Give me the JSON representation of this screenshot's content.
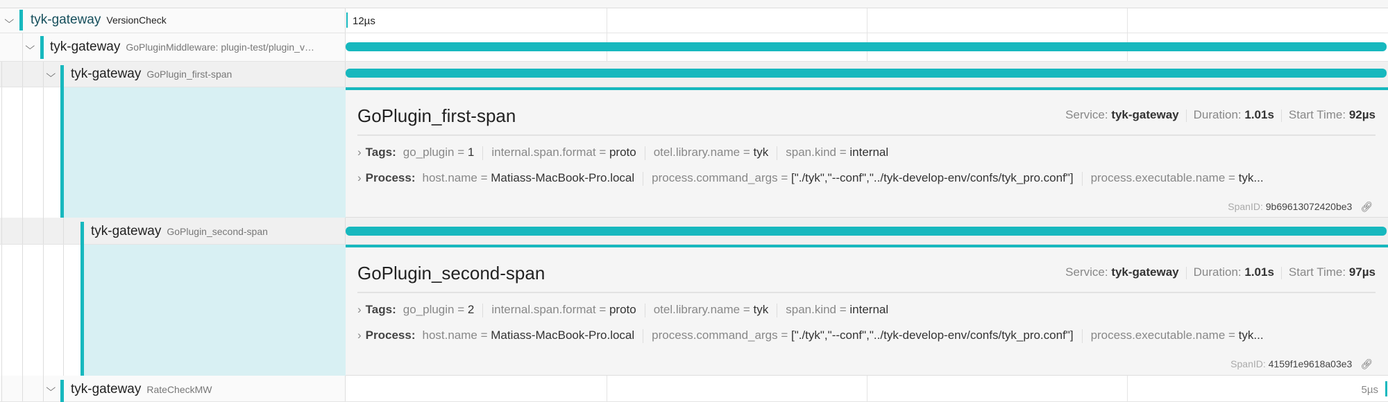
{
  "rows": [
    {
      "service": "tyk-gateway",
      "operation": "VersionCheck",
      "duration": "12µs"
    },
    {
      "service": "tyk-gateway",
      "operation": "GoPluginMiddleware: plugin-test/plugin_v…"
    },
    {
      "service": "tyk-gateway",
      "operation": "GoPlugin_first-span"
    },
    {
      "service": "tyk-gateway",
      "operation": "GoPlugin_second-span"
    },
    {
      "service": "tyk-gateway",
      "operation": "RateCheckMW",
      "duration": "5µs"
    }
  ],
  "details": [
    {
      "title": "GoPlugin_first-span",
      "service_label": "Service:",
      "service": "tyk-gateway",
      "duration_label": "Duration:",
      "duration": "1.01s",
      "start_label": "Start Time:",
      "start": "92µs",
      "tags_label": "Tags:",
      "tags": [
        {
          "k": "go_plugin",
          "v": "1"
        },
        {
          "k": "internal.span.format",
          "v": "proto"
        },
        {
          "k": "otel.library.name",
          "v": "tyk"
        },
        {
          "k": "span.kind",
          "v": "internal"
        }
      ],
      "process_label": "Process:",
      "process": [
        {
          "k": "host.name",
          "v": "Matiass-MacBook-Pro.local"
        },
        {
          "k": "process.command_args",
          "v": "[\"./tyk\",\"--conf\",\"../tyk-develop-env/confs/tyk_pro.conf\"]"
        },
        {
          "k": "process.executable.name",
          "v": "tyk..."
        }
      ],
      "spanid_label": "SpanID:",
      "spanid": "9b69613072420be3"
    },
    {
      "title": "GoPlugin_second-span",
      "service_label": "Service:",
      "service": "tyk-gateway",
      "duration_label": "Duration:",
      "duration": "1.01s",
      "start_label": "Start Time:",
      "start": "97µs",
      "tags_label": "Tags:",
      "tags": [
        {
          "k": "go_plugin",
          "v": "2"
        },
        {
          "k": "internal.span.format",
          "v": "proto"
        },
        {
          "k": "otel.library.name",
          "v": "tyk"
        },
        {
          "k": "span.kind",
          "v": "internal"
        }
      ],
      "process_label": "Process:",
      "process": [
        {
          "k": "host.name",
          "v": "Matiass-MacBook-Pro.local"
        },
        {
          "k": "process.command_args",
          "v": "[\"./tyk\",\"--conf\",\"../tyk-develop-env/confs/tyk_pro.conf\"]"
        },
        {
          "k": "process.executable.name",
          "v": "tyk..."
        }
      ],
      "spanid_label": "SpanID:",
      "spanid": "4159f1e9618a03e3"
    }
  ],
  "colors": {
    "service": "#17b8be",
    "detail_bg": "#f5f5f5",
    "selected_bg": "#d8f0f3"
  }
}
